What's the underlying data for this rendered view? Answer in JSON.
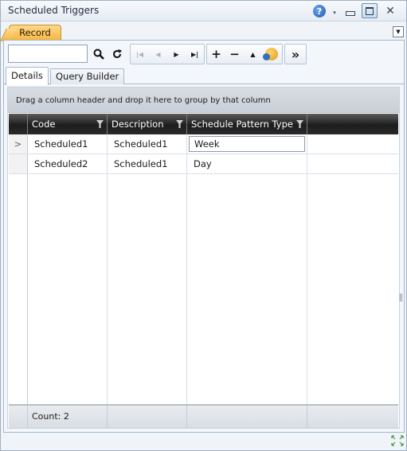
{
  "window": {
    "title": "Scheduled Triggers",
    "help_icon": "question-mark",
    "help_label": "?",
    "help_arrow": "▾",
    "close_glyph": "✕"
  },
  "tabs": {
    "record_label": "Record",
    "menu_glyph": "▼"
  },
  "toolbar": {
    "search_value": "",
    "search_icon": "magnifier",
    "refresh_icon": "refresh-arrow",
    "nav": [
      {
        "name": "first",
        "glyph": "|◀",
        "enabled": false
      },
      {
        "name": "previous",
        "glyph": "◀",
        "enabled": false
      },
      {
        "name": "next",
        "glyph": "▶",
        "enabled": true
      },
      {
        "name": "last",
        "glyph": "▶|",
        "enabled": true
      }
    ],
    "actions": [
      {
        "name": "add",
        "glyph": "+"
      },
      {
        "name": "delete",
        "glyph": "−"
      },
      {
        "name": "move-up",
        "glyph": "▲"
      }
    ],
    "more_glyph": "»"
  },
  "subtabs": {
    "details": "Details",
    "query_builder": "Query Builder"
  },
  "grid": {
    "group_hint": "Drag a column header and drop it here to group by that column",
    "columns": [
      "Code",
      "Description",
      "Schedule Pattern Type"
    ],
    "rows": [
      {
        "indicator": ">",
        "code": "Scheduled1",
        "description": "Scheduled1",
        "type": "Week"
      },
      {
        "indicator": "",
        "code": "Scheduled2",
        "description": "Scheduled1",
        "type": "Day"
      }
    ],
    "footer_count": "Count: 2",
    "header_color": "#1d1d1d"
  },
  "colors": {
    "record_tab": "#f6b540",
    "window_bg": "#f0f4f8"
  }
}
